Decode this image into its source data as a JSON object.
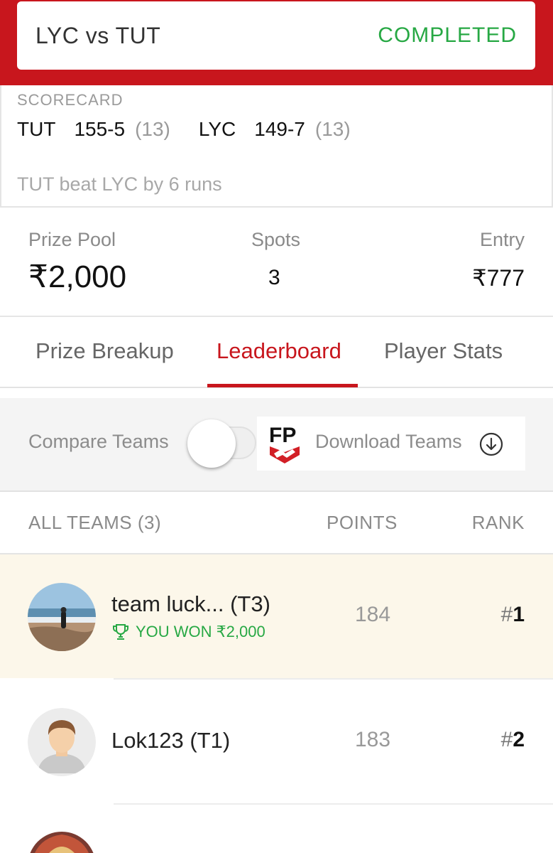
{
  "match": {
    "title": "LYC vs TUT",
    "status": "COMPLETED"
  },
  "scorecard": {
    "label": "SCORECARD",
    "innings": [
      {
        "team": "TUT",
        "score": "155-5",
        "overs": "(13)"
      },
      {
        "team": "LYC",
        "score": "149-7",
        "overs": "(13)"
      }
    ],
    "result": "TUT beat LYC by 6 runs"
  },
  "contest": {
    "prize_pool_label": "Prize Pool",
    "prize_pool": "₹2,000",
    "spots_label": "Spots",
    "spots": "3",
    "entry_label": "Entry",
    "entry": "₹777"
  },
  "tabs": [
    {
      "label": "Prize Breakup",
      "active": false
    },
    {
      "label": "Leaderboard",
      "active": true
    },
    {
      "label": "Player Stats",
      "active": false
    }
  ],
  "tools": {
    "compare_label": "Compare Teams",
    "compare_on": false,
    "fp_logo_text": "FP",
    "download_label": "Download Teams"
  },
  "list_header": {
    "teams": "ALL TEAMS (3)",
    "points": "POINTS",
    "rank": "RANK"
  },
  "teams": [
    {
      "name": "team luck... (T3)",
      "won": "YOU WON ₹2,000",
      "points": "184",
      "rank_hash": "#",
      "rank": "1",
      "avatar": "beach-photo",
      "highlight": true
    },
    {
      "name": "Lok123 (T1)",
      "won": "",
      "points": "183",
      "rank_hash": "#",
      "rank": "2",
      "avatar": "default-person",
      "highlight": false
    }
  ],
  "colors": {
    "brand": "#c8161d",
    "success": "#27a844",
    "winner_row": "#fcf7ea"
  }
}
